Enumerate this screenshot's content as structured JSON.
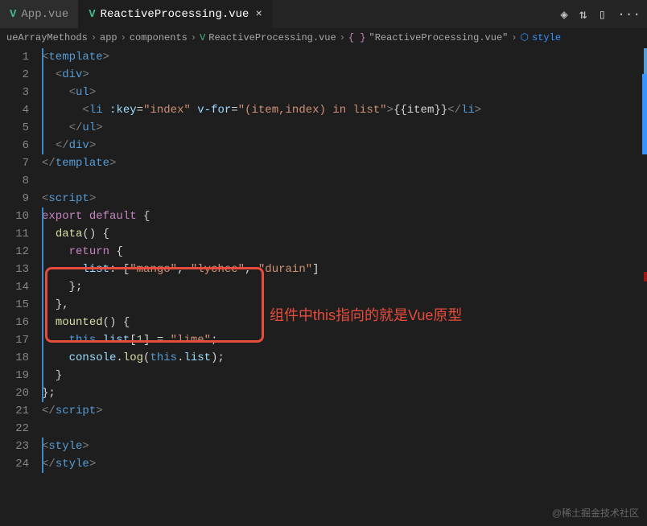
{
  "tabs": {
    "inactive": "App.vue",
    "active": "ReactiveProcessing.vue",
    "close": "×"
  },
  "toolbar": {
    "diff": "◈",
    "compare": "⇅",
    "split": "▯",
    "more": "···"
  },
  "breadcrumbs": {
    "b0": "ueArrayMethods",
    "b1": "app",
    "b2": "components",
    "b3": "ReactiveProcessing.vue",
    "b4": "\"ReactiveProcessing.vue\"",
    "b5": "style",
    "sep": "›",
    "brace": "{ }"
  },
  "lines": {
    "l1": "1",
    "l2": "2",
    "l3": "3",
    "l4": "4",
    "l5": "5",
    "l6": "6",
    "l7": "7",
    "l8": "8",
    "l9": "9",
    "l10": "10",
    "l11": "11",
    "l12": "12",
    "l13": "13",
    "l14": "14",
    "l15": "15",
    "l16": "16",
    "l17": "17",
    "l18": "18",
    "l19": "19",
    "l20": "20",
    "l21": "21",
    "l22": "22",
    "l23": "23",
    "l24": "24"
  },
  "code": {
    "template_open": "template",
    "div": "div",
    "ul": "ul",
    "li": "li",
    "key_attr": ":key",
    "key_val": "\"index\"",
    "vfor_attr": "v-for",
    "vfor_val": "\"(item,index) in list\"",
    "item_expr": "{{item}}",
    "script_tag": "script",
    "export": "export",
    "default": "default",
    "data_fn": "data",
    "return": "return",
    "list_prop": "list",
    "mango": "\"mango\"",
    "lychee": "\"lychee\"",
    "durain": "\"durain\"",
    "mounted_fn": "mounted",
    "this": "this",
    "list_access": "list",
    "idx": "1",
    "lime": "\"lime\"",
    "console": "console",
    "log": "log",
    "style_tag": "style"
  },
  "annotation": "组件中this指向的就是Vue原型",
  "watermark": "@稀土掘金技术社区"
}
